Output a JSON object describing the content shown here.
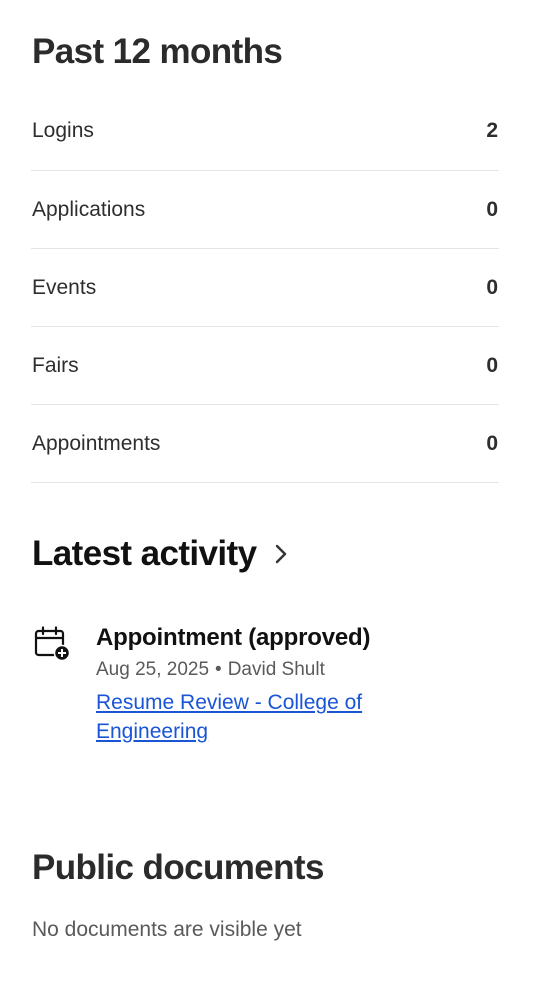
{
  "stats": {
    "title": "Past 12 months",
    "rows": [
      {
        "label": "Logins",
        "value": "2"
      },
      {
        "label": "Applications",
        "value": "0"
      },
      {
        "label": "Events",
        "value": "0"
      },
      {
        "label": "Fairs",
        "value": "0"
      },
      {
        "label": "Appointments",
        "value": "0"
      }
    ]
  },
  "activity": {
    "title": "Latest activity",
    "chevron_icon": "chevron-right-icon",
    "items": [
      {
        "icon": "calendar-add-icon",
        "title": "Appointment (approved)",
        "date": "Aug 25, 2025",
        "separator": "•",
        "person": "David Shult",
        "link": "Resume Review - College of Engineering"
      }
    ]
  },
  "documents": {
    "title": "Public documents",
    "empty_text": "No documents are visible yet"
  },
  "colors": {
    "link": "#1a55d6",
    "divider": "#e4e4e4",
    "muted_text": "#5a5a5a"
  }
}
